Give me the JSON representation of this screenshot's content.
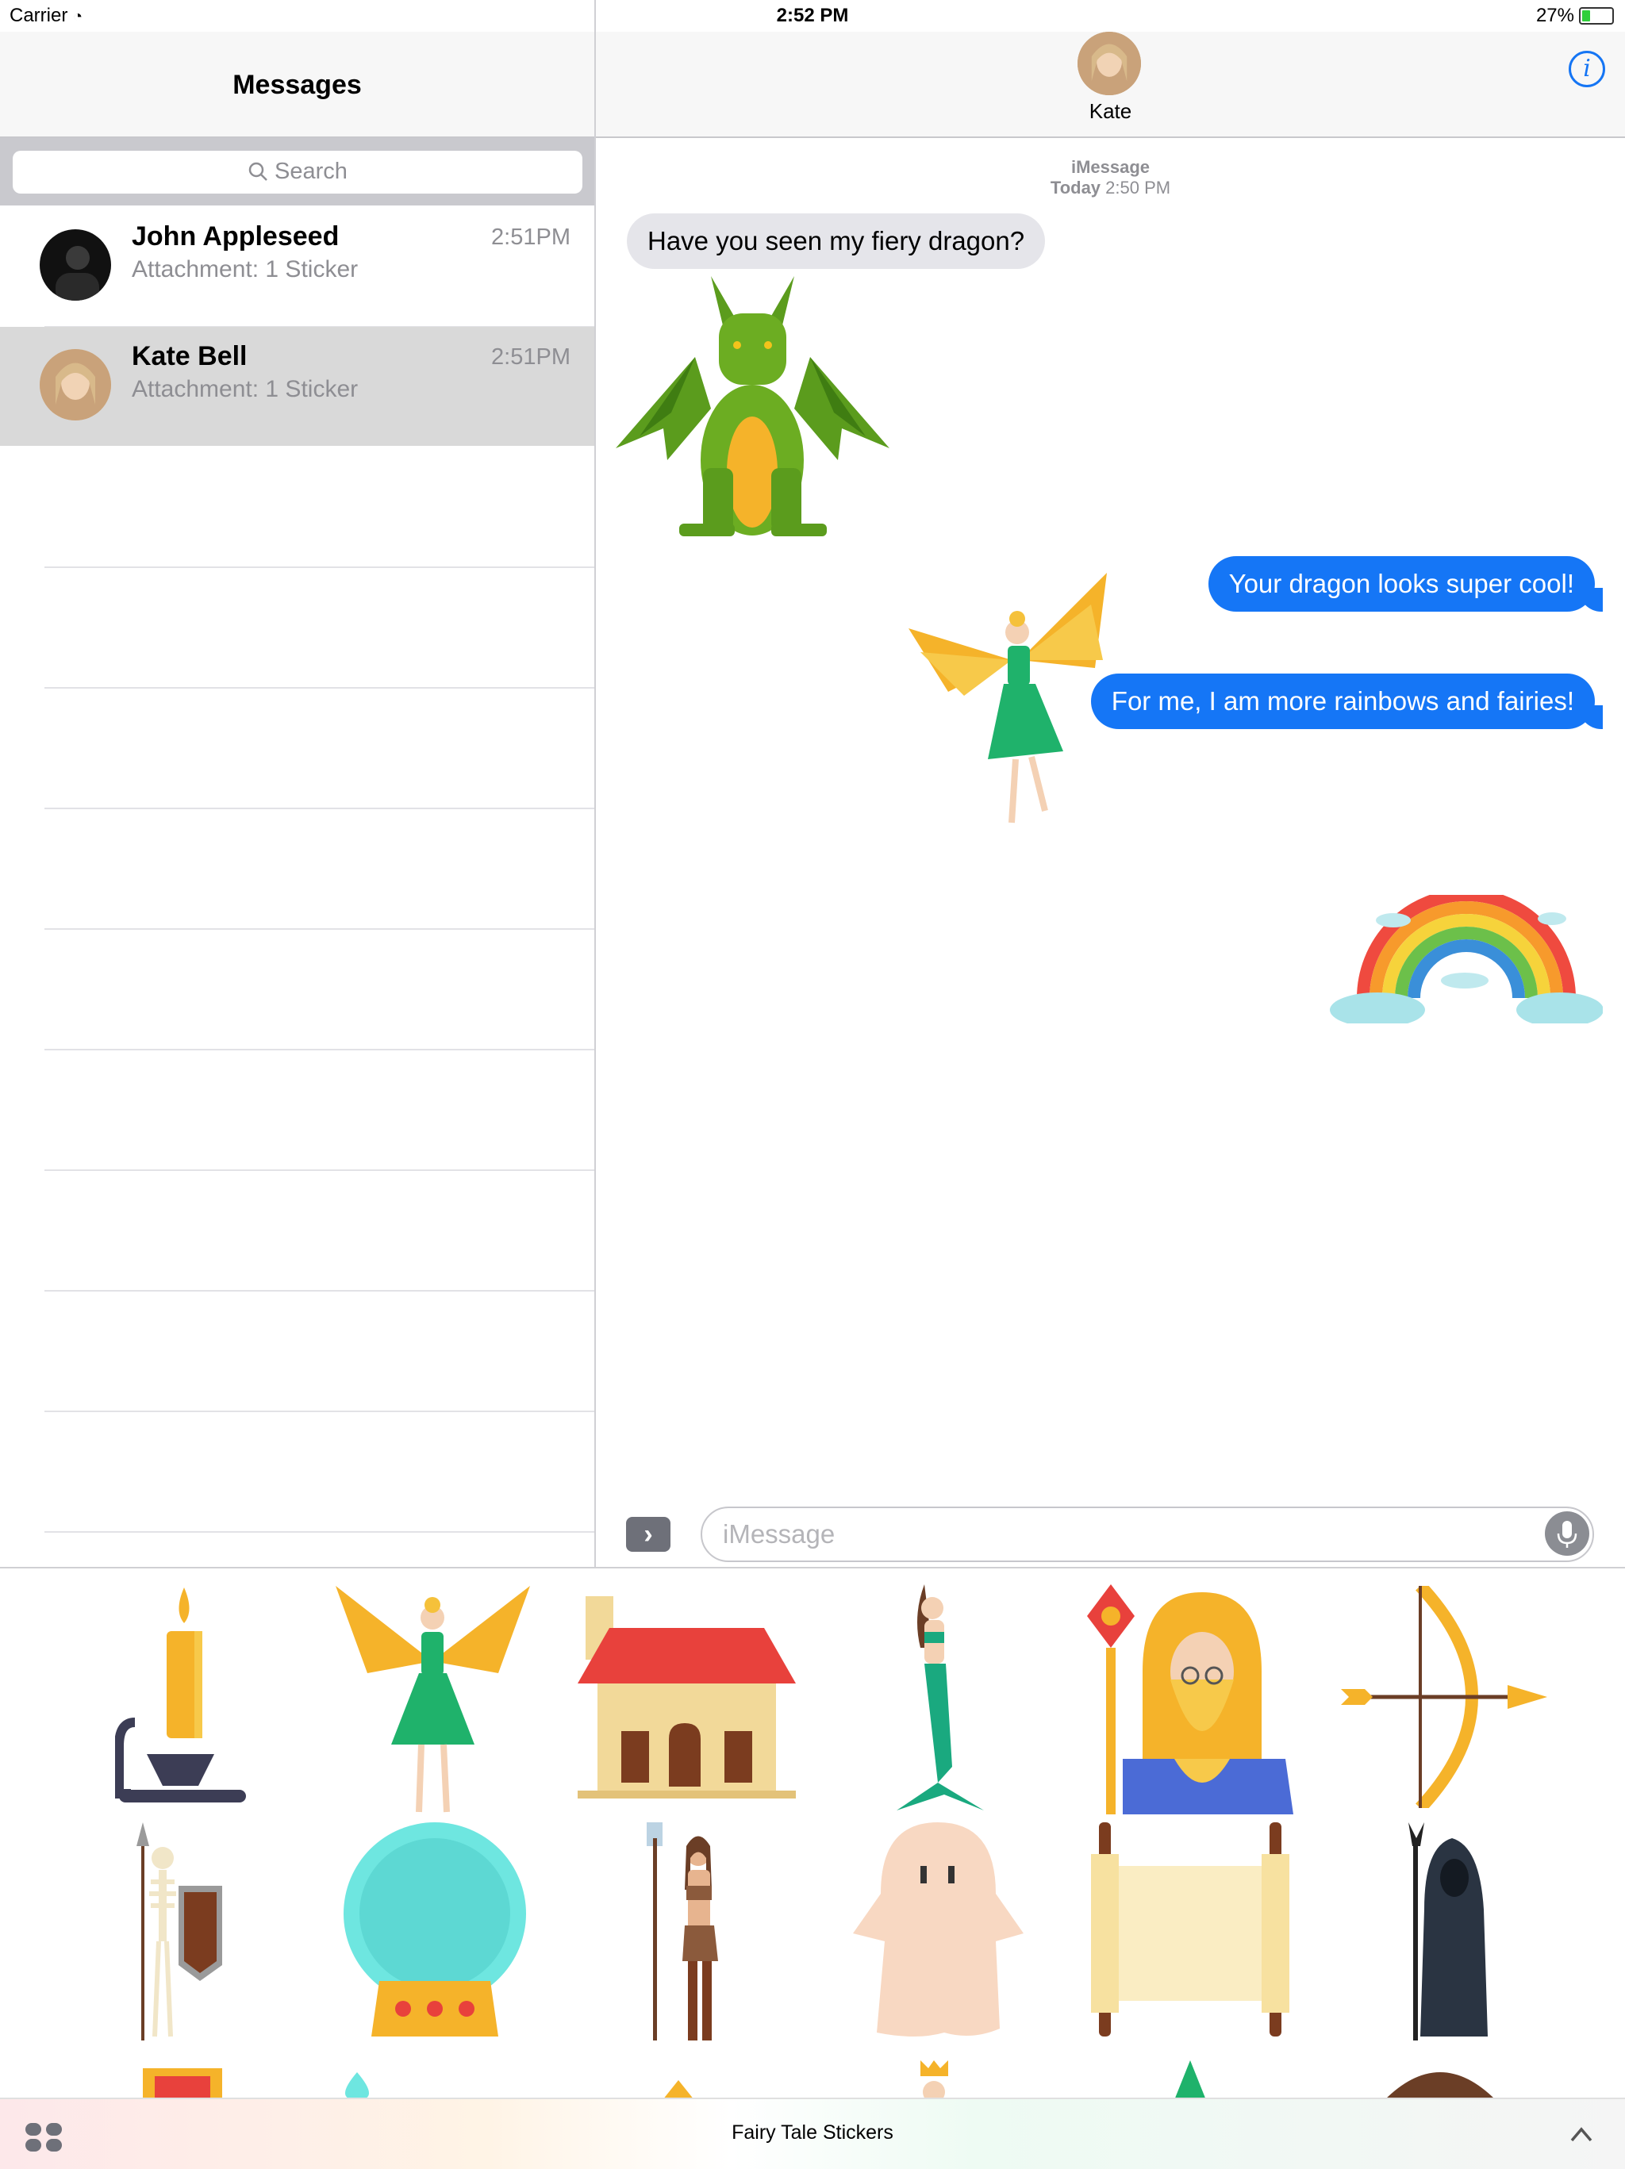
{
  "status_bar": {
    "carrier": "Carrier",
    "time": "2:52 PM",
    "battery": "27%"
  },
  "sidebar": {
    "title": "Messages",
    "search_placeholder": "Search",
    "conversations": [
      {
        "name": "John Appleseed",
        "preview": "Attachment: 1 Sticker",
        "time": "2:51PM",
        "selected": false
      },
      {
        "name": "Kate Bell",
        "preview": "Attachment: 1 Sticker",
        "time": "2:51PM",
        "selected": true
      }
    ]
  },
  "chat": {
    "contact": "Kate",
    "service": "iMessage",
    "timestamp_day": "Today",
    "timestamp_time": "2:50 PM",
    "messages": [
      {
        "from": "them",
        "type": "text",
        "text": "Have you seen my fiery dragon?"
      },
      {
        "from": "them",
        "type": "sticker",
        "sticker": "dragon"
      },
      {
        "from": "me",
        "type": "text",
        "text": "Your dragon looks super cool!"
      },
      {
        "from": "me",
        "type": "sticker",
        "sticker": "fairy"
      },
      {
        "from": "me",
        "type": "text",
        "text": "For me, I am more rainbows and fairies!"
      },
      {
        "from": "me",
        "type": "sticker",
        "sticker": "rainbow"
      }
    ],
    "input_placeholder": "iMessage"
  },
  "drawer": {
    "title": "Fairy Tale Stickers",
    "stickers": [
      "candle",
      "fairy",
      "house",
      "mermaid",
      "wizard",
      "bow-and-arrow",
      "skeleton-warrior",
      "crystal-ball",
      "warrior-woman",
      "ghost",
      "scroll",
      "grim-reaper"
    ]
  },
  "colors": {
    "accent": "#1576f6",
    "incoming": "#e5e5ea",
    "selected_row": "#d9d9d9"
  }
}
